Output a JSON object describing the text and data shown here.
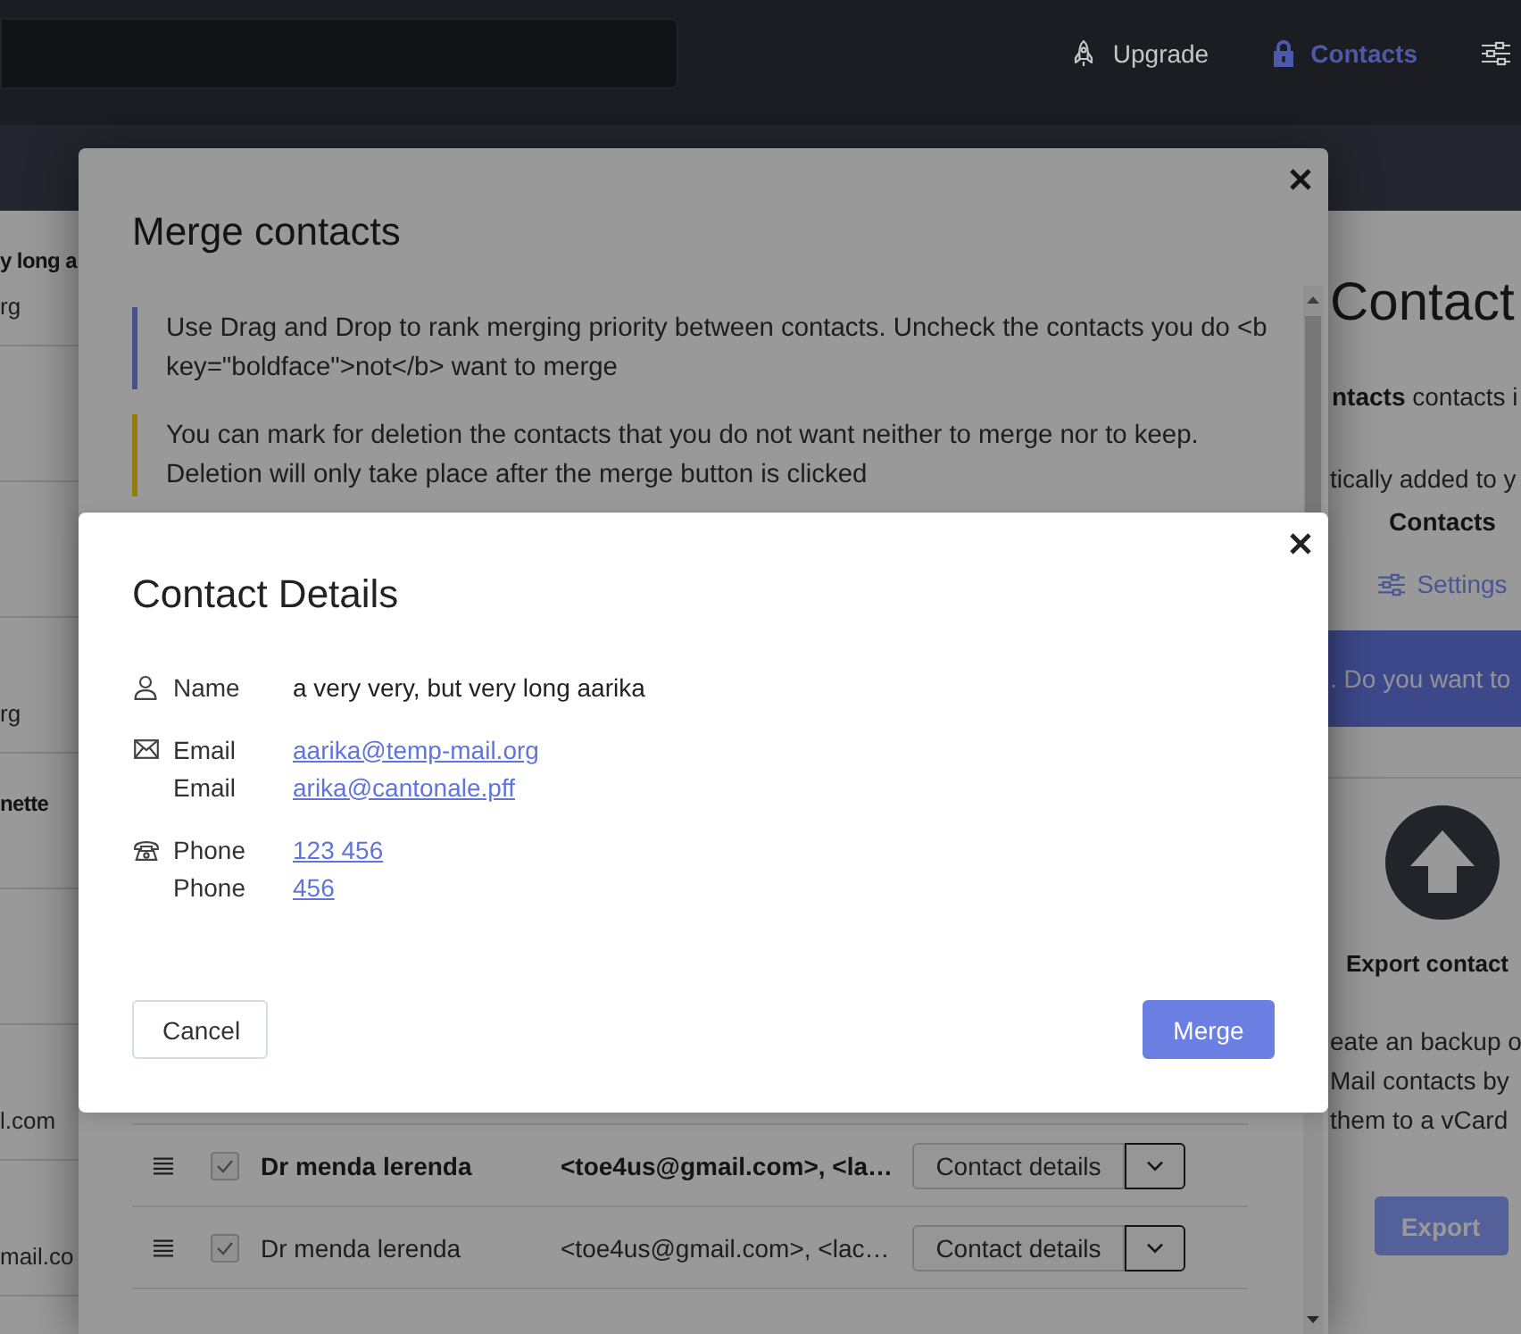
{
  "header": {
    "nav": [
      {
        "label": "Upgrade",
        "selected": false
      },
      {
        "label": "Contacts",
        "selected": true
      }
    ]
  },
  "contact_list": [
    {
      "name": "y long a",
      "email": "rg"
    },
    {
      "email": "rg"
    },
    {
      "name": "nette"
    },
    {
      "email": "l.com"
    },
    {
      "email": "mail.co"
    }
  ],
  "side_panel": {
    "title": "Contact",
    "summary": "**ntacts** contacts i",
    "auto_add_text": "tically added to y",
    "auto_add_label": "Contacts",
    "settings_link": "Settings",
    "banner": ". Do you want to",
    "export_title": "Export contact",
    "export_lines": [
      "eate an backup o",
      "Mail contacts by",
      "them to a vCard"
    ],
    "export_button": "Export"
  },
  "merge_dialog": {
    "title": "Merge contacts",
    "notes": [
      {
        "kind": "info",
        "text": "Use Drag and Drop to rank merging priority between contacts. Uncheck the contacts you do <b key=\"boldface\">not</b> want to merge"
      },
      {
        "kind": "warning",
        "text": "You can mark for deletion the contacts that you do not want neither to merge nor to keep. Deletion will only take place after the merge button is clicked"
      }
    ],
    "rows": [
      {
        "name": "Dr menda lerenda",
        "emails": "<toe4us@gmail.com>, <la…",
        "checked": true,
        "primary": true,
        "action": "Contact details"
      },
      {
        "name": "Dr menda lerenda",
        "emails": "<toe4us@gmail.com>, <lac…",
        "checked": true,
        "primary": false,
        "action": "Contact details"
      }
    ]
  },
  "details_dialog": {
    "title": "Contact Details",
    "groups": [
      {
        "kind": "name",
        "entries": [
          {
            "label": "Name",
            "value": "a very very, but very long aarika"
          }
        ]
      },
      {
        "kind": "email",
        "entries": [
          {
            "label": "Email",
            "value": "aarika@temp-mail.org"
          },
          {
            "label": "Email",
            "value": "arika@cantonale.pff"
          }
        ]
      },
      {
        "kind": "phone",
        "entries": [
          {
            "label": "Phone",
            "value": "123 456"
          },
          {
            "label": "Phone",
            "value": "456"
          }
        ]
      }
    ],
    "buttons": [
      {
        "kind": "secondary",
        "label": "Cancel"
      },
      {
        "kind": "primary",
        "label": "Merge"
      }
    ]
  }
}
